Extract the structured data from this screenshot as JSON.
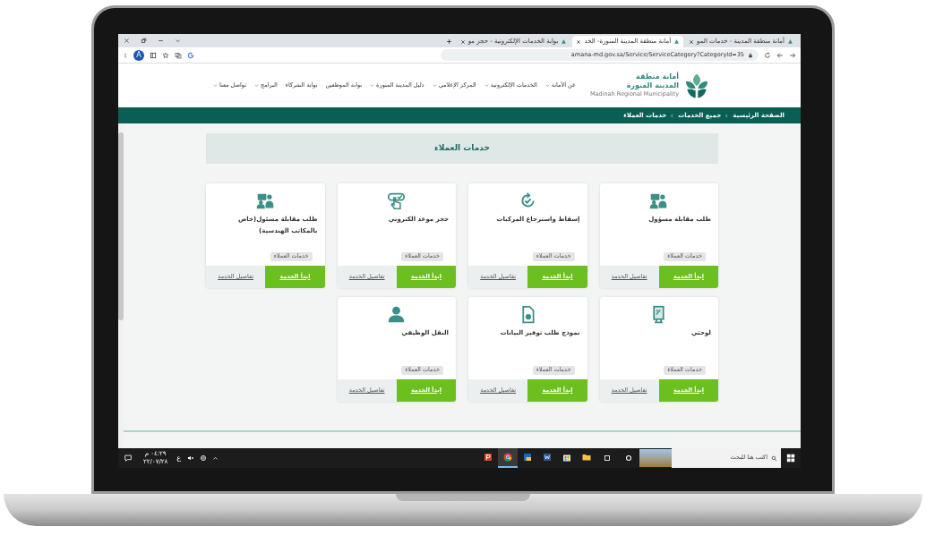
{
  "browser": {
    "tabs": [
      {
        "title": "أمانة منطقة المدينة - خدمات المو",
        "selected": false
      },
      {
        "title": "أمانة منطقة المدينة المنورة- الخد",
        "selected": true
      },
      {
        "title": "بوابة الخدمات الإلكترونية - حجز مو",
        "selected": false
      }
    ],
    "address": "amana-md.gov.sa/Service/ServiceCategory?CategoryId=35",
    "profile": "A"
  },
  "header": {
    "logo_title": "أمانة منطقة المدينة المنورة",
    "logo_subtitle": "Madinah Regional Municipality",
    "nav": [
      {
        "label": "عن الأمانة",
        "dropdown": true
      },
      {
        "label": "الخدمات الإلكترونية",
        "dropdown": true
      },
      {
        "label": "المركز الإعلامي",
        "dropdown": true
      },
      {
        "label": "دليل المدينة المنورة",
        "dropdown": true
      },
      {
        "label": "بوابة الموظفين",
        "dropdown": false
      },
      {
        "label": "بوابة الشركاء",
        "dropdown": false
      },
      {
        "label": "البرامج",
        "dropdown": true
      },
      {
        "label": "تواصل معنا",
        "dropdown": true
      }
    ]
  },
  "breadcrumb": [
    "الصفحة الرئيسية",
    "جميع الخدمات",
    "خدمات العملاء"
  ],
  "page_title": "خدمات العملاء",
  "cards": [
    {
      "kind": "meeting",
      "title": "طلب مقابلة مسؤول",
      "tag": "خدمات العملاء",
      "start": "ابدأ الخدمة",
      "details": "تفاصيل الخدمة"
    },
    {
      "kind": "refresh",
      "title": "إسقاط واسترجاع المركبات",
      "tag": "خدمات العملاء",
      "start": "ابدأ الخدمة",
      "details": "تفاصيل الخدمة"
    },
    {
      "kind": "touch",
      "title": "حجز موعد الكتروني",
      "tag": "خدمات العملاء",
      "start": "ابدأ الخدمة",
      "details": "تفاصيل الخدمة"
    },
    {
      "kind": "meeting",
      "title": "طلب مقابلة مسئول(خاص بالمكاتب الهندسية)",
      "tag": "خدمات العملاء",
      "start": "ابدأ الخدمة",
      "details": "تفاصيل الخدمة"
    },
    {
      "kind": "billboard",
      "title": "لوحتي",
      "tag": "خدمات العملاء",
      "start": "ابدأ الخدمة",
      "details": "تفاصيل الخدمة"
    },
    {
      "kind": "document",
      "title": "نموذج طلب توفير البيانات",
      "tag": "خدمات العملاء",
      "start": "ابدأ الخدمة",
      "details": "تفاصيل الخدمة"
    },
    {
      "kind": "person",
      "title": "النقل الوظيفي",
      "tag": "خدمات العملاء",
      "start": "ابدأ الخدمة",
      "details": "تفاصيل الخدمة"
    }
  ],
  "taskbar": {
    "search_placeholder": "اكتب هنا للبحث",
    "time": "٠٤:٢٩ م",
    "date": "٢٢/٠٧/٢٨",
    "language": "ع",
    "apps": [
      {
        "kind": "explorer",
        "active": false
      },
      {
        "kind": "store",
        "active": false
      },
      {
        "kind": "word",
        "active": false
      },
      {
        "kind": "outlook",
        "active": false
      },
      {
        "kind": "chrome",
        "active": true
      },
      {
        "kind": "powerpoint",
        "active": false
      }
    ]
  }
}
